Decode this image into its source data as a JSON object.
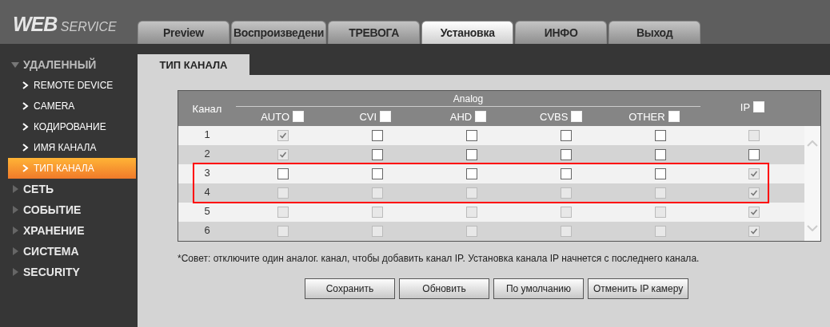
{
  "logo": {
    "main": "WEB",
    "sub": "SERVICE"
  },
  "tabs": [
    {
      "label": "Preview",
      "selected": false
    },
    {
      "label": "Воспроизведени",
      "selected": false
    },
    {
      "label": "ТРЕВОГА",
      "selected": false
    },
    {
      "label": "Установка",
      "selected": true
    },
    {
      "label": "ИНФО",
      "selected": false
    },
    {
      "label": "Выход",
      "selected": false
    }
  ],
  "sidebar": {
    "items": [
      {
        "label": "УДАЛЕННЫЙ",
        "expanded": true,
        "children": [
          {
            "label": "REMOTE DEVICE",
            "selected": false
          },
          {
            "label": "CAMERA",
            "selected": false
          },
          {
            "label": "КОДИРОВАНИЕ",
            "selected": false
          },
          {
            "label": "ИМЯ КАНАЛА",
            "selected": false
          },
          {
            "label": "ТИП КАНАЛА",
            "selected": true
          }
        ]
      },
      {
        "label": "СЕТЬ",
        "expanded": false
      },
      {
        "label": "СОБЫТИЕ",
        "expanded": false
      },
      {
        "label": "ХРАНЕНИЕ",
        "expanded": false
      },
      {
        "label": "СИСТЕМА",
        "expanded": false
      },
      {
        "label": "SECURITY",
        "expanded": false
      }
    ]
  },
  "subtab": {
    "label": "ТИП КАНАЛА"
  },
  "table": {
    "channel_header": "Канал",
    "group_header": "Analog",
    "columns": [
      {
        "label": "AUTO",
        "checked": false
      },
      {
        "label": "CVI",
        "checked": false
      },
      {
        "label": "AHD",
        "checked": false
      },
      {
        "label": "CVBS",
        "checked": false
      },
      {
        "label": "OTHER",
        "checked": false
      },
      {
        "label": "IP",
        "checked": false
      }
    ],
    "rows": [
      {
        "channel": "1",
        "highlighted": false,
        "cells": [
          {
            "checked": true,
            "disabled": true
          },
          {
            "checked": false,
            "disabled": false
          },
          {
            "checked": false,
            "disabled": false
          },
          {
            "checked": false,
            "disabled": false
          },
          {
            "checked": false,
            "disabled": false
          },
          {
            "checked": false,
            "disabled": true
          }
        ]
      },
      {
        "channel": "2",
        "highlighted": false,
        "cells": [
          {
            "checked": true,
            "disabled": true
          },
          {
            "checked": false,
            "disabled": false
          },
          {
            "checked": false,
            "disabled": false
          },
          {
            "checked": false,
            "disabled": false
          },
          {
            "checked": false,
            "disabled": false
          },
          {
            "checked": false,
            "disabled": false
          }
        ]
      },
      {
        "channel": "3",
        "highlighted": true,
        "cells": [
          {
            "checked": false,
            "disabled": false
          },
          {
            "checked": false,
            "disabled": false
          },
          {
            "checked": false,
            "disabled": false
          },
          {
            "checked": false,
            "disabled": false
          },
          {
            "checked": false,
            "disabled": false
          },
          {
            "checked": true,
            "disabled": true
          }
        ]
      },
      {
        "channel": "4",
        "highlighted": true,
        "cells": [
          {
            "checked": false,
            "disabled": true
          },
          {
            "checked": false,
            "disabled": true
          },
          {
            "checked": false,
            "disabled": true
          },
          {
            "checked": false,
            "disabled": true
          },
          {
            "checked": false,
            "disabled": true
          },
          {
            "checked": true,
            "disabled": true
          }
        ]
      },
      {
        "channel": "5",
        "highlighted": false,
        "cells": [
          {
            "checked": false,
            "disabled": true
          },
          {
            "checked": false,
            "disabled": true
          },
          {
            "checked": false,
            "disabled": true
          },
          {
            "checked": false,
            "disabled": true
          },
          {
            "checked": false,
            "disabled": true
          },
          {
            "checked": true,
            "disabled": true
          }
        ]
      },
      {
        "channel": "6",
        "highlighted": false,
        "cells": [
          {
            "checked": false,
            "disabled": true
          },
          {
            "checked": false,
            "disabled": true
          },
          {
            "checked": false,
            "disabled": true
          },
          {
            "checked": false,
            "disabled": true
          },
          {
            "checked": false,
            "disabled": true
          },
          {
            "checked": true,
            "disabled": true
          }
        ]
      }
    ]
  },
  "hint": "*Совет: отключите один аналог. канал, чтобы добавить канал IP. Установка канала IP начнется с последнего канала.",
  "buttons": [
    "Сохранить",
    "Обновить",
    "По умолчанию",
    "Отменить IP камеру"
  ]
}
